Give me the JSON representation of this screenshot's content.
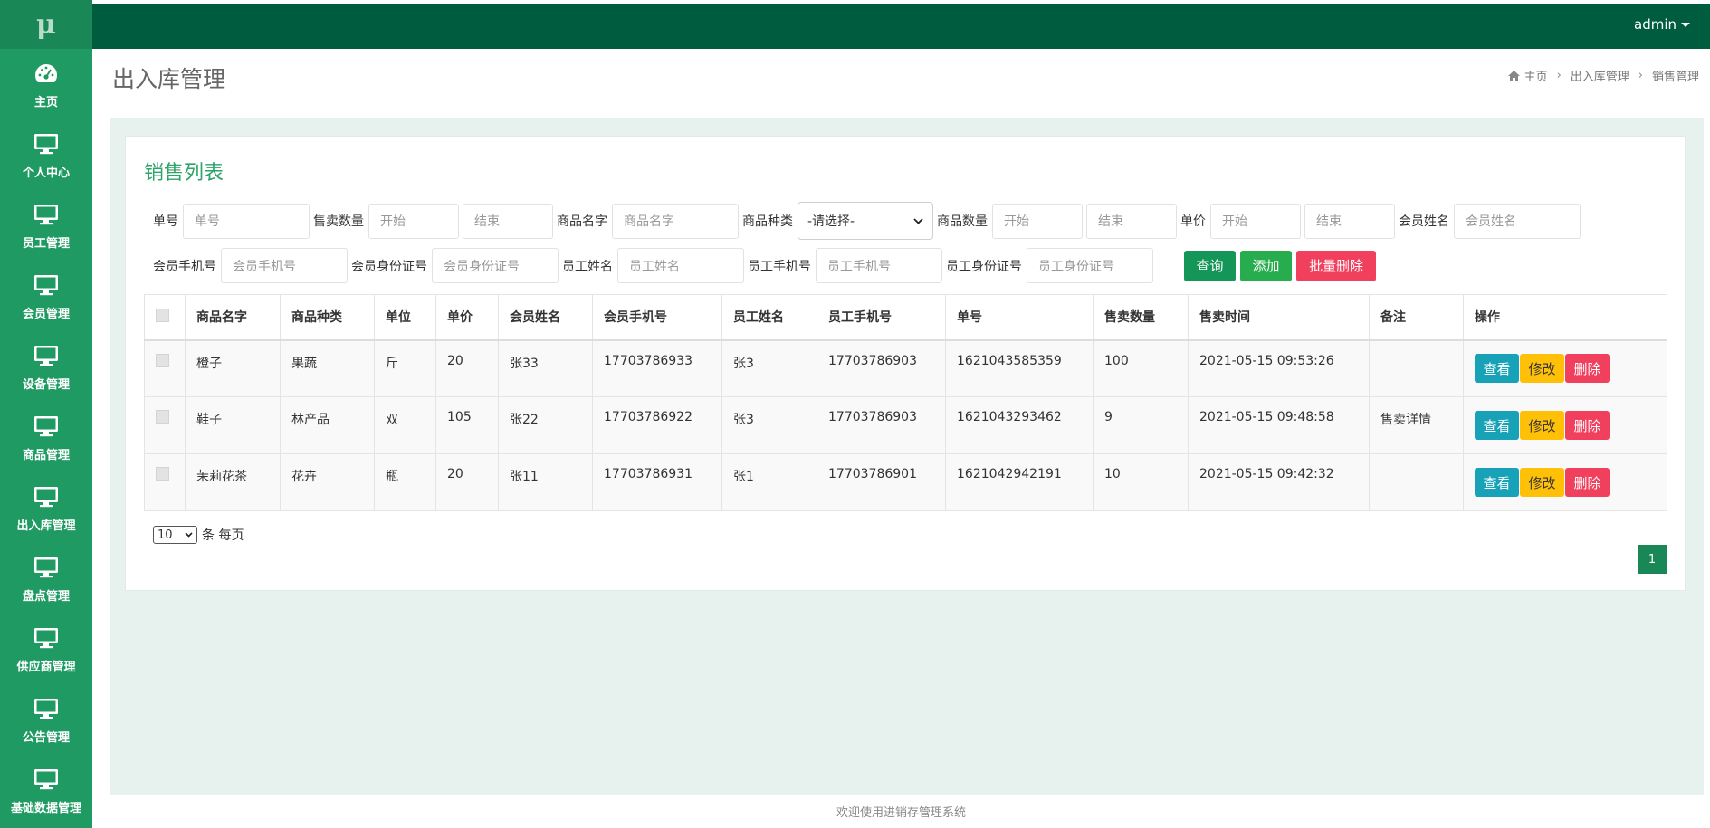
{
  "app": {
    "logo": "μ"
  },
  "topbar": {
    "user": "admin"
  },
  "sidebar": {
    "items": [
      {
        "label": "主页",
        "icon": "dashboard-icon"
      },
      {
        "label": "个人中心",
        "icon": "monitor-icon"
      },
      {
        "label": "员工管理",
        "icon": "monitor-icon"
      },
      {
        "label": "会员管理",
        "icon": "monitor-icon"
      },
      {
        "label": "设备管理",
        "icon": "monitor-icon"
      },
      {
        "label": "商品管理",
        "icon": "monitor-icon"
      },
      {
        "label": "出入库管理",
        "icon": "monitor-icon"
      },
      {
        "label": "盘点管理",
        "icon": "monitor-icon"
      },
      {
        "label": "供应商管理",
        "icon": "monitor-icon"
      },
      {
        "label": "公告管理",
        "icon": "monitor-icon"
      },
      {
        "label": "基础数据管理",
        "icon": "monitor-icon"
      }
    ]
  },
  "header": {
    "title": "出入库管理",
    "breadcrumb": [
      "主页",
      "出入库管理",
      "销售管理"
    ]
  },
  "panel": {
    "title": "销售列表"
  },
  "search": {
    "order_no_label": "单号",
    "order_no_ph": "单号",
    "sale_qty_label": "售卖数量",
    "sale_qty_start_ph": "开始",
    "sale_qty_end_ph": "结束",
    "goods_name_label": "商品名字",
    "goods_name_ph": "商品名字",
    "goods_type_label": "商品种类",
    "goods_type_value": "-请选择-",
    "goods_qty_label": "商品数量",
    "goods_qty_start_ph": "开始",
    "goods_qty_end_ph": "结束",
    "price_label": "单价",
    "price_start_ph": "开始",
    "price_end_ph": "结束",
    "member_name_label": "会员姓名",
    "member_name_ph": "会员姓名",
    "member_phone_label": "会员手机号",
    "member_phone_ph": "会员手机号",
    "member_id_label": "会员身份证号",
    "member_id_ph": "会员身份证号",
    "staff_name_label": "员工姓名",
    "staff_name_ph": "员工姓名",
    "staff_phone_label": "员工手机号",
    "staff_phone_ph": "员工手机号",
    "staff_id_label": "员工身份证号",
    "staff_id_ph": "员工身份证号",
    "query_label": "查询",
    "add_label": "添加",
    "batch_delete_label": "批量删除"
  },
  "table": {
    "headers": [
      "商品名字",
      "商品种类",
      "单位",
      "单价",
      "会员姓名",
      "会员手机号",
      "员工姓名",
      "员工手机号",
      "单号",
      "售卖数量",
      "售卖时间",
      "备注",
      "操作"
    ],
    "rows": [
      [
        "橙子",
        "果蔬",
        "斤",
        "20",
        "张33",
        "17703786933",
        "张3",
        "17703786903",
        "1621043585359",
        "100",
        "2021-05-15 09:53:26",
        ""
      ],
      [
        "鞋子",
        "林产品",
        "双",
        "105",
        "张22",
        "17703786922",
        "张3",
        "17703786903",
        "1621043293462",
        "9",
        "2021-05-15 09:48:58",
        "售卖详情"
      ],
      [
        "茉莉花茶",
        "花卉",
        "瓶",
        "20",
        "张11",
        "17703786931",
        "张1",
        "17703786901",
        "1621042942191",
        "10",
        "2021-05-15 09:42:32",
        ""
      ]
    ],
    "op_view": "查看",
    "op_edit": "修改",
    "op_delete": "删除"
  },
  "pager": {
    "page_size": "10",
    "per_page_label": "条 每页",
    "current_page": "1"
  },
  "footer": {
    "text": "欢迎使用进销存管理系统"
  },
  "colors": {
    "sidebar": "#1f9a62",
    "topbar": "#005c3e",
    "accent": "#2ea36a"
  }
}
